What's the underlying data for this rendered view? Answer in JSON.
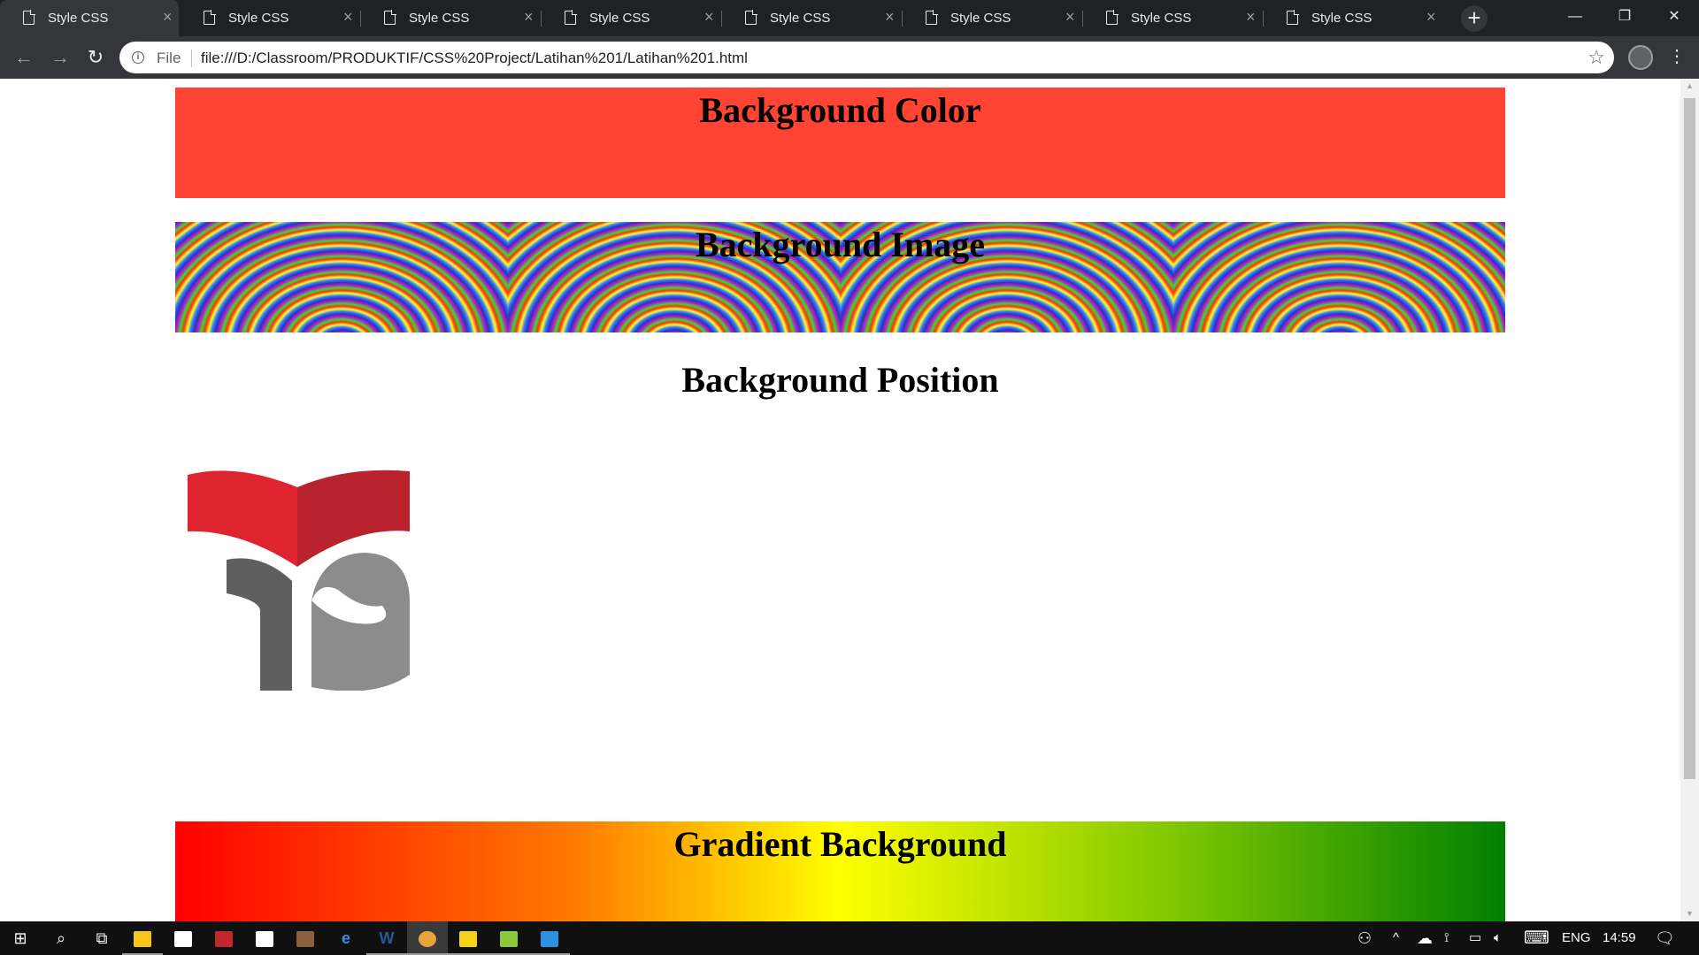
{
  "browser": {
    "tabs": [
      {
        "title": "Style CSS",
        "active": true
      },
      {
        "title": "Style CSS",
        "active": false
      },
      {
        "title": "Style CSS",
        "active": false
      },
      {
        "title": "Style CSS",
        "active": false
      },
      {
        "title": "Style CSS",
        "active": false
      },
      {
        "title": "Style CSS",
        "active": false
      },
      {
        "title": "Style CSS",
        "active": false
      },
      {
        "title": "Style CSS",
        "active": false
      }
    ],
    "tab_close_glyph": "×",
    "new_tab_glyph": "+",
    "window_controls": {
      "minimize": "—",
      "restore": "❐",
      "close": "✕"
    },
    "toolbar": {
      "back_glyph": "←",
      "forward_glyph": "→",
      "reload_glyph": "↻",
      "info_glyph": "i",
      "scheme": "File",
      "url": "file:///D:/Classroom/PRODUKTIF/CSS%20Project/Latihan%201/Latihan%201.html",
      "star_glyph": "☆",
      "menu_glyph": "⋮"
    }
  },
  "page": {
    "sections": {
      "color": {
        "heading": "Background Color",
        "bg": "#ff4433"
      },
      "image": {
        "heading": "Background Image"
      },
      "position": {
        "heading": "Background Position"
      },
      "gradient": {
        "heading": "Gradient Background",
        "stops": [
          "#ff0000",
          "#ff7a00",
          "#ffff00",
          "#7fc800",
          "#008000"
        ]
      }
    },
    "logo": {
      "colors": {
        "red_left": "#e0242f",
        "red_right": "#b8232d",
        "gray_dark": "#5f5f5f",
        "gray_light": "#8c8c8c"
      }
    }
  },
  "taskbar": {
    "items": [
      {
        "name": "start",
        "glyph": "⊞"
      },
      {
        "name": "search",
        "glyph": "⌕"
      },
      {
        "name": "task-view",
        "glyph": "⧉"
      },
      {
        "name": "file-explorer",
        "color": "#f5c518"
      },
      {
        "name": "store",
        "color": "#ffffff"
      },
      {
        "name": "gift",
        "color": "#c4262e"
      },
      {
        "name": "mail",
        "color": "#ffffff"
      },
      {
        "name": "app",
        "color": "#8b5e3c"
      },
      {
        "name": "edge",
        "glyph": "e",
        "color": "#3b8ee0"
      },
      {
        "name": "word",
        "glyph": "W",
        "color": "#2b579a"
      },
      {
        "name": "chrome",
        "color": "#e8a33d"
      },
      {
        "name": "sticky-notes",
        "color": "#f7d21a"
      },
      {
        "name": "notepad-plus",
        "color": "#90c83c"
      },
      {
        "name": "vscode",
        "color": "#2f8fe0"
      }
    ],
    "tray": {
      "language": "ENG",
      "time": "14:59",
      "glyphs": {
        "people": "⚇",
        "chevron": "^",
        "cloud": "☁",
        "wifi": "⟟",
        "battery": "▭",
        "volume": "🔈︎",
        "keyboard": "⌨",
        "notifications": "🗨︎"
      }
    }
  }
}
